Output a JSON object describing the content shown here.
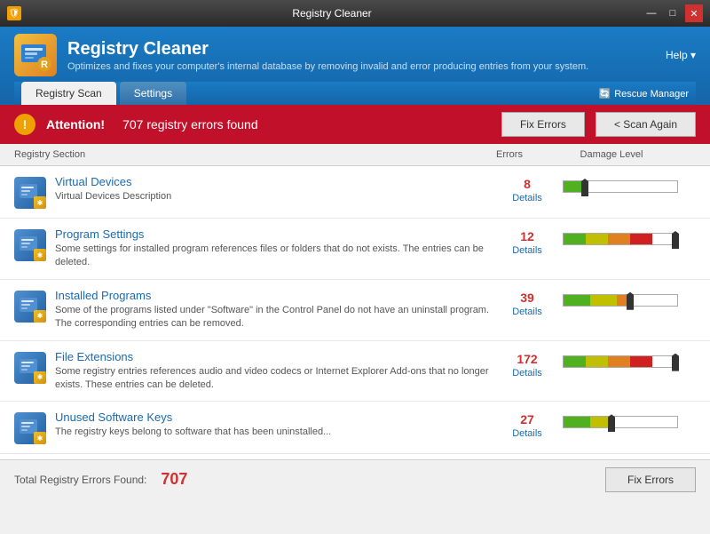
{
  "window": {
    "title": "Registry Cleaner",
    "controls": {
      "minimize": "—",
      "maximize": "□",
      "close": "✕"
    }
  },
  "header": {
    "title": "Registry Cleaner",
    "subtitle": "Optimizes and fixes your computer's internal database by removing invalid and error producing entries from your system.",
    "help_label": "Help ▾"
  },
  "tabs": [
    {
      "id": "registry-scan",
      "label": "Registry Scan",
      "active": true
    },
    {
      "id": "settings",
      "label": "Settings",
      "active": false
    }
  ],
  "rescue_manager": "Rescue Manager",
  "attention": {
    "text": "Attention!",
    "detail": "707 registry errors found",
    "fix_btn": "Fix Errors",
    "scan_btn": "< Scan Again"
  },
  "table_headers": {
    "section": "Registry Section",
    "errors": "Errors",
    "damage": "Damage Level"
  },
  "rows": [
    {
      "title": "Virtual Devices",
      "desc": "Virtual Devices Description",
      "errors": "8",
      "details": "Details",
      "damage_level": 1
    },
    {
      "title": "Program Settings",
      "desc": "Some settings for installed program references files or folders that do not exists. The entries can be deleted.",
      "errors": "12",
      "details": "Details",
      "damage_level": 4
    },
    {
      "title": "Installed Programs",
      "desc": "Some of the programs listed under \"Software\" in the Control Panel do not have an uninstall program. The corresponding entries can be removed.",
      "errors": "39",
      "details": "Details",
      "damage_level": 3
    },
    {
      "title": "File Extensions",
      "desc": "Some registry entries references audio and video codecs or Internet Explorer Add-ons that no longer exists. These entries can be deleted.",
      "errors": "172",
      "details": "Details",
      "damage_level": 4
    },
    {
      "title": "Unused Software Keys",
      "desc": "The registry keys belong to software that has been uninstalled...",
      "errors": "27",
      "details": "Details",
      "damage_level": 2
    }
  ],
  "footer": {
    "label": "Total Registry Errors Found:",
    "count": "707",
    "fix_btn": "Fix Errors"
  }
}
